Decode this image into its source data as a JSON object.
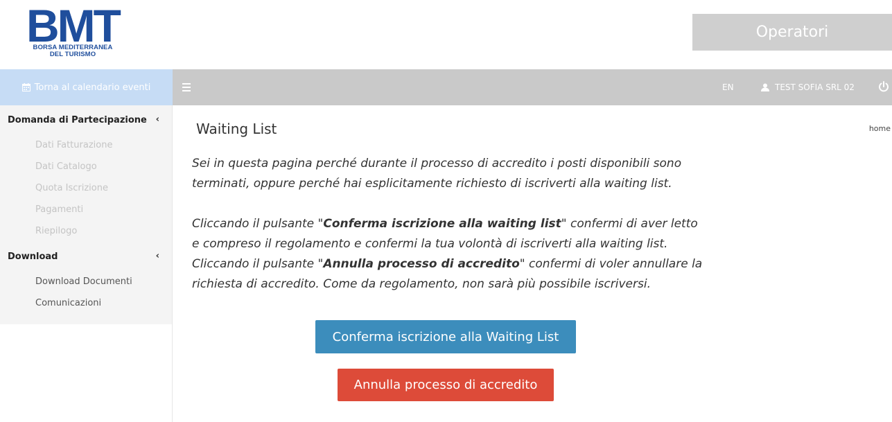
{
  "header": {
    "logo_text": "BMT",
    "logo_subtitle_line1": "BORSA MEDITERRANEA",
    "logo_subtitle_line2": "DEL TURISMO",
    "operatori_label": "Operatori"
  },
  "topbar": {
    "back_label": "Torna al calendario eventi",
    "lang_label": "EN",
    "user_label": "TEST SOFIA SRL 02"
  },
  "sidebar": {
    "sections": [
      {
        "title": "Domanda di Partecipazione",
        "items": [
          "Dati Fatturazione",
          "Dati Catalogo",
          "Quota Iscrizione",
          "Pagamenti",
          "Riepilogo"
        ]
      },
      {
        "title": "Download",
        "items": [
          "Download Documenti",
          "Comunicazioni"
        ]
      }
    ]
  },
  "main": {
    "title": "Waiting List",
    "breadcrumb": "home",
    "para1": "Sei in questa pagina perché durante il processo di accredito i posti disponibili sono terminati, oppure perché hai esplicitamente richiesto di iscriverti alla waiting list.",
    "para2_a": "Cliccando il pulsante \"",
    "para2_b": "Conferma iscrizione alla waiting list",
    "para2_c": "\" confermi di aver letto e compreso il regolamento e confermi la tua volontà di iscriverti alla waiting list. Cliccando il pulsante \"",
    "para2_d": "Annulla processo di accredito",
    "para2_e": "\" confermi di voler annullare la richiesta di accredito. Come da regolamento, non sarà più possibile iscriversi.",
    "confirm_button": "Conferma iscrizione alla Waiting List",
    "cancel_button": "Annulla processo di accredito"
  },
  "colors": {
    "brand_blue": "#1f4e9c",
    "confirm_button": "#3c8dbc",
    "cancel_button": "#dd4b39",
    "topbar": "#c9c9c9",
    "back_link": "#c6dcf5",
    "sidebar_bg": "#f4f4f4"
  }
}
